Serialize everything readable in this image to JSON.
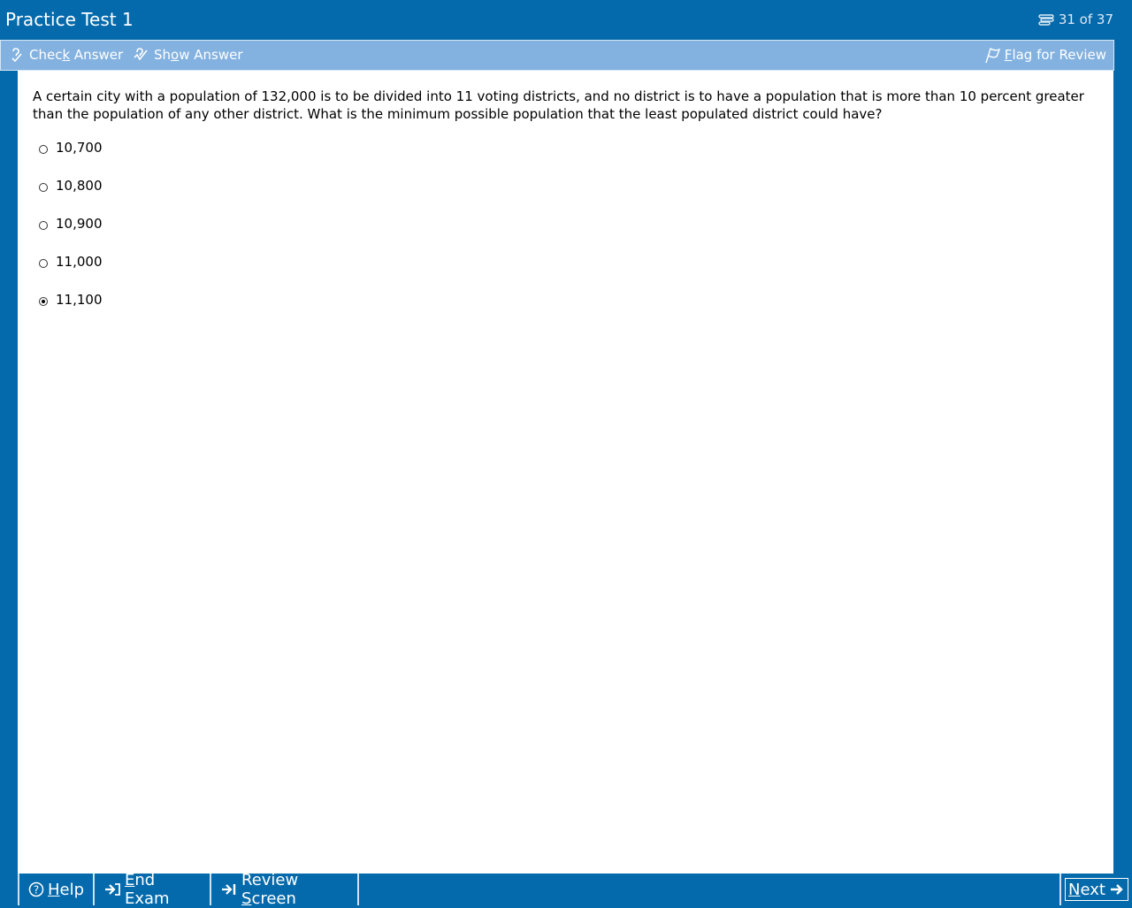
{
  "header": {
    "title": "Practice Test 1",
    "counter_icon": "paperclip-icon",
    "counter": "31 of 37"
  },
  "toolbar": {
    "check_answer": {
      "pre": "Chec",
      "key": "k",
      "post": " Answer",
      "icon": "check-answer-icon"
    },
    "show_answer": {
      "pre": "Sh",
      "key": "o",
      "post": "w Answer",
      "icon": "show-answer-icon"
    },
    "flag_review": {
      "pre": "",
      "key": "F",
      "post": "lag for Review",
      "icon": "flag-icon"
    }
  },
  "question": {
    "text": "A certain city with a population of 132,000 is to be divided into 11 voting districts, and no district is to have a population that is more than 10 percent greater than the population of any other district.  What is the minimum possible population that the least populated district could have?",
    "options": [
      {
        "label": "10,700",
        "selected": false
      },
      {
        "label": "10,800",
        "selected": false
      },
      {
        "label": "10,900",
        "selected": false
      },
      {
        "label": "11,000",
        "selected": false
      },
      {
        "label": "11,100",
        "selected": true
      }
    ]
  },
  "footer": {
    "help": {
      "pre": "",
      "key": "H",
      "post": "elp",
      "icon": "help-icon"
    },
    "end_exam": {
      "pre": "",
      "key": "E",
      "post": "nd Exam",
      "icon": "end-exam-icon"
    },
    "review_screen": {
      "pre": "Review ",
      "key": "S",
      "post": "creen",
      "icon": "review-screen-icon"
    },
    "next": {
      "pre": "",
      "key": "N",
      "post": "ext",
      "icon": "arrow-right-icon"
    }
  },
  "colors": {
    "frame": "#056aab",
    "toolbar": "#83b2e0",
    "content": "#ffffff"
  }
}
